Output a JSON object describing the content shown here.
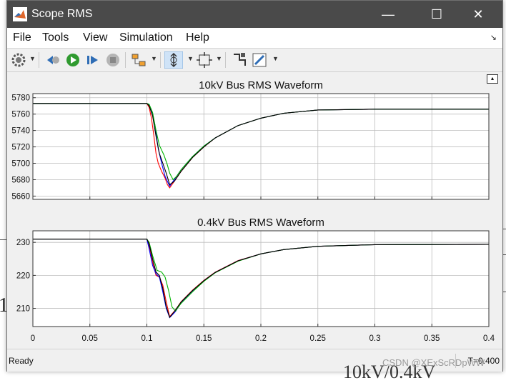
{
  "window": {
    "title": "Scope RMS",
    "minimize": "—",
    "maximize": "☐",
    "close": "✕"
  },
  "menu": [
    "File",
    "Tools",
    "View",
    "Simulation",
    "Help"
  ],
  "toolbar_icons": [
    "gear-icon",
    "step-back-icon",
    "run-icon",
    "step-forward-icon",
    "stop-icon",
    "highlight-block-icon",
    "zoom-icon",
    "autoscale-icon",
    "cursor-measure-icon",
    "style-edit-icon"
  ],
  "status": {
    "text": "Ready",
    "time": "T=0.400"
  },
  "watermark": "CSDN @XExScRDpWW",
  "colors": {
    "series": [
      "#ff0000",
      "#0000ff",
      "#00b400",
      "#000000"
    ]
  },
  "chart_data": [
    {
      "type": "line",
      "title": "10kV Bus RMS Waveform",
      "xlim": [
        0,
        0.4
      ],
      "ylim": [
        5656,
        5785
      ],
      "yticks": [
        5780,
        5760,
        5740,
        5720,
        5700,
        5680,
        5660
      ],
      "grid": true,
      "series": [
        {
          "values": [
            [
              0,
              5773
            ],
            [
              0.1,
              5773
            ],
            [
              0.102,
              5768
            ],
            [
              0.104,
              5755
            ],
            [
              0.106,
              5735
            ],
            [
              0.108,
              5712
            ],
            [
              0.11,
              5700
            ],
            [
              0.113,
              5690
            ],
            [
              0.116,
              5682
            ],
            [
              0.118,
              5674
            ],
            [
              0.12,
              5670
            ],
            [
              0.125,
              5680
            ],
            [
              0.13,
              5690
            ],
            [
              0.14,
              5707
            ],
            [
              0.15,
              5720
            ],
            [
              0.16,
              5731
            ],
            [
              0.18,
              5746
            ],
            [
              0.2,
              5755
            ],
            [
              0.22,
              5761
            ],
            [
              0.25,
              5765
            ],
            [
              0.3,
              5766
            ],
            [
              0.4,
              5766
            ]
          ]
        },
        {
          "values": [
            [
              0,
              5773
            ],
            [
              0.1,
              5773
            ],
            [
              0.102,
              5771
            ],
            [
              0.104,
              5765
            ],
            [
              0.107,
              5747
            ],
            [
              0.11,
              5718
            ],
            [
              0.113,
              5700
            ],
            [
              0.116,
              5684
            ],
            [
              0.12,
              5672
            ],
            [
              0.125,
              5682
            ],
            [
              0.13,
              5692
            ],
            [
              0.14,
              5708
            ],
            [
              0.15,
              5721
            ],
            [
              0.16,
              5731
            ],
            [
              0.18,
              5746
            ],
            [
              0.2,
              5755
            ],
            [
              0.22,
              5761
            ],
            [
              0.25,
              5765
            ],
            [
              0.3,
              5766
            ],
            [
              0.4,
              5766
            ]
          ]
        },
        {
          "values": [
            [
              0,
              5773
            ],
            [
              0.1,
              5773
            ],
            [
              0.102,
              5772
            ],
            [
              0.105,
              5762
            ],
            [
              0.108,
              5740
            ],
            [
              0.111,
              5722
            ],
            [
              0.115,
              5710
            ],
            [
              0.118,
              5698
            ],
            [
              0.12,
              5688
            ],
            [
              0.123,
              5680
            ],
            [
              0.126,
              5684
            ],
            [
              0.13,
              5692
            ],
            [
              0.14,
              5708
            ],
            [
              0.15,
              5721
            ],
            [
              0.16,
              5731
            ],
            [
              0.18,
              5746
            ],
            [
              0.2,
              5755
            ],
            [
              0.22,
              5761
            ],
            [
              0.25,
              5765
            ],
            [
              0.3,
              5766
            ],
            [
              0.4,
              5766
            ]
          ]
        },
        {
          "values": [
            [
              0,
              5773
            ],
            [
              0.1,
              5773
            ],
            [
              0.102,
              5770
            ],
            [
              0.105,
              5758
            ],
            [
              0.108,
              5733
            ],
            [
              0.111,
              5712
            ],
            [
              0.114,
              5700
            ],
            [
              0.117,
              5688
            ],
            [
              0.12,
              5674
            ],
            [
              0.124,
              5678
            ],
            [
              0.13,
              5690
            ],
            [
              0.14,
              5707
            ],
            [
              0.15,
              5720
            ],
            [
              0.16,
              5731
            ],
            [
              0.18,
              5746
            ],
            [
              0.2,
              5755
            ],
            [
              0.22,
              5761
            ],
            [
              0.25,
              5765
            ],
            [
              0.3,
              5766
            ],
            [
              0.4,
              5766
            ]
          ]
        }
      ]
    },
    {
      "type": "line",
      "title": "0.4kV Bus RMS Waveform",
      "xlim": [
        0,
        0.4
      ],
      "ylim": [
        204.5,
        233.5
      ],
      "xticks": [
        0,
        0.05,
        0.1,
        0.15,
        0.2,
        0.25,
        0.3,
        0.35,
        0.4
      ],
      "yticks": [
        230,
        220,
        210
      ],
      "grid": true,
      "series": [
        {
          "values": [
            [
              0,
              231
            ],
            [
              0.1,
              231
            ],
            [
              0.102,
              229
            ],
            [
              0.105,
              224
            ],
            [
              0.108,
              220
            ],
            [
              0.111,
              219.5
            ],
            [
              0.114,
              217
            ],
            [
              0.117,
              212
            ],
            [
              0.12,
              207.5
            ],
            [
              0.125,
              209.5
            ],
            [
              0.13,
              212
            ],
            [
              0.14,
              215.5
            ],
            [
              0.15,
              218.5
            ],
            [
              0.16,
              221
            ],
            [
              0.18,
              224.5
            ],
            [
              0.2,
              226.5
            ],
            [
              0.22,
              227.8
            ],
            [
              0.25,
              228.8
            ],
            [
              0.3,
              229.3
            ],
            [
              0.4,
              229.4
            ]
          ]
        },
        {
          "values": [
            [
              0,
              231
            ],
            [
              0.1,
              231
            ],
            [
              0.102,
              228
            ],
            [
              0.105,
              223
            ],
            [
              0.108,
              220.5
            ],
            [
              0.111,
              219.5
            ],
            [
              0.114,
              215
            ],
            [
              0.117,
              210
            ],
            [
              0.12,
              207.2
            ],
            [
              0.125,
              209
            ],
            [
              0.13,
              211.8
            ],
            [
              0.14,
              215.3
            ],
            [
              0.15,
              218.4
            ],
            [
              0.16,
              220.9
            ],
            [
              0.18,
              224.4
            ],
            [
              0.2,
              226.5
            ],
            [
              0.22,
              227.8
            ],
            [
              0.25,
              228.8
            ],
            [
              0.3,
              229.3
            ],
            [
              0.4,
              229.4
            ]
          ]
        },
        {
          "values": [
            [
              0,
              231
            ],
            [
              0.1,
              231
            ],
            [
              0.102,
              230
            ],
            [
              0.105,
              226
            ],
            [
              0.109,
              221.5
            ],
            [
              0.113,
              221
            ],
            [
              0.116,
              219.5
            ],
            [
              0.119,
              215.5
            ],
            [
              0.122,
              210.5
            ],
            [
              0.125,
              209.2
            ],
            [
              0.13,
              211.5
            ],
            [
              0.14,
              215
            ],
            [
              0.15,
              218.2
            ],
            [
              0.16,
              220.8
            ],
            [
              0.18,
              224.3
            ],
            [
              0.2,
              226.5
            ],
            [
              0.22,
              227.8
            ],
            [
              0.25,
              228.8
            ],
            [
              0.3,
              229.3
            ],
            [
              0.4,
              229.4
            ]
          ]
        },
        {
          "values": [
            [
              0,
              231
            ],
            [
              0.1,
              231
            ],
            [
              0.102,
              229.5
            ],
            [
              0.105,
              225
            ],
            [
              0.108,
              221
            ],
            [
              0.111,
              220
            ],
            [
              0.114,
              216
            ],
            [
              0.117,
              210.5
            ],
            [
              0.12,
              207.3
            ],
            [
              0.124,
              209
            ],
            [
              0.13,
              211.9
            ],
            [
              0.14,
              215.4
            ],
            [
              0.15,
              218.4
            ],
            [
              0.16,
              220.9
            ],
            [
              0.18,
              224.4
            ],
            [
              0.2,
              226.5
            ],
            [
              0.22,
              227.8
            ],
            [
              0.25,
              228.8
            ],
            [
              0.3,
              229.3
            ],
            [
              0.4,
              229.4
            ]
          ]
        }
      ]
    }
  ]
}
